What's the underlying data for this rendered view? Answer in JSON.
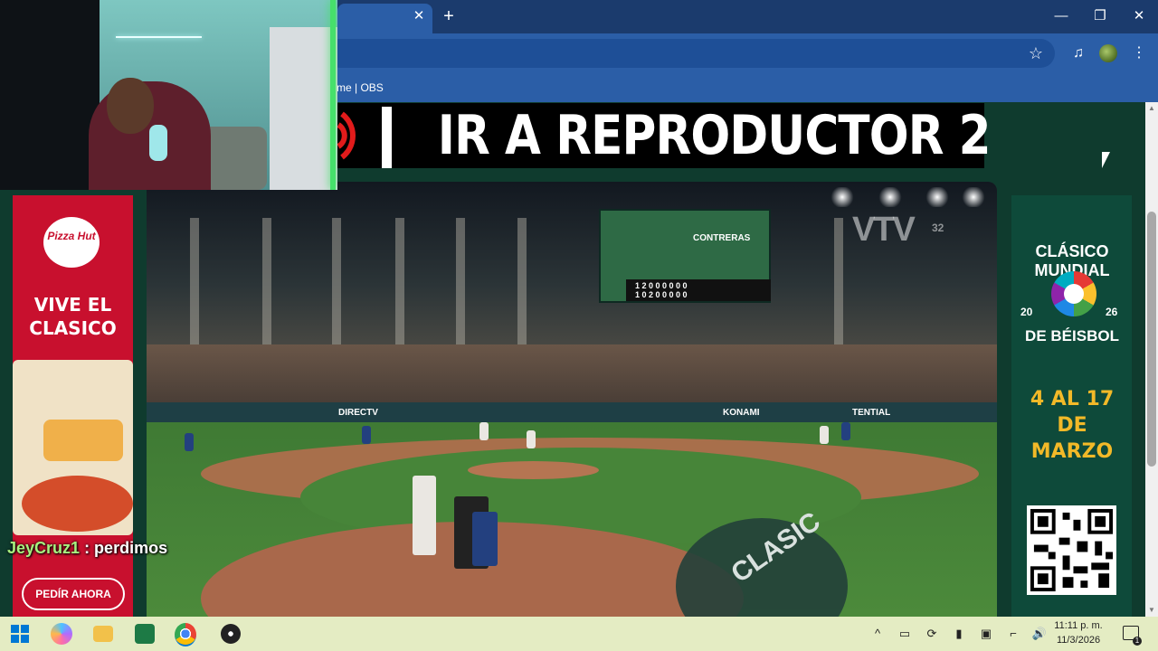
{
  "browser": {
    "tab_close": "✕",
    "new_tab": "+",
    "window": {
      "minimize": "—",
      "restore": "❐",
      "close": "✕"
    },
    "bookmarks": [
      "me | OBS"
    ]
  },
  "stream": {
    "banner_text": "IR A REPRODUCTOR 2"
  },
  "video": {
    "watermark": "VTV",
    "watermark_channel": "32",
    "board_title": "CONTRERAS",
    "board_line1": "1 2 0 0 0 0 0 0",
    "board_line2": "1 0 2 0 0 0 0 0",
    "field_text": "CLASIC",
    "sponsor_1": "DIRECTV",
    "sponsor_2": "KONAMI",
    "sponsor_3": "TENTIAL"
  },
  "ad_left": {
    "logo_text": "Pizza Hut",
    "headline_line1": "VIVE EL",
    "headline_line2": "CLASICO",
    "cta_label": "PEDÍR AHORA"
  },
  "chat": {
    "username": "JeyCruz1",
    "message": ": perdimos"
  },
  "ad_right": {
    "title_top": "CLÁSICO MUNDIAL",
    "year_left": "20",
    "year_right": "26",
    "title_bottom": "DE BÉISBOL",
    "dates_line1": "4 AL 17",
    "dates_line2": "DE",
    "dates_line3": "MARZO"
  },
  "taskbar": {
    "time": "11:11 p. m.",
    "date": "11/3/2026",
    "notif_count": "1"
  },
  "colors": {
    "tabbar": "#1b3b6d",
    "toolbar": "#2b5ea7",
    "page_bg": "#0f3b2e",
    "ad_red": "#c8102e",
    "dates_gold": "#f2b928",
    "taskbar": "#e4ecc3"
  },
  "icons": {
    "star": "☆",
    "media": "♫",
    "menu": "⋮",
    "tray_up": "^",
    "tray_1": "▭",
    "tray_2": "⟳",
    "tray_3": "▮",
    "tray_4": "▣",
    "tray_5": "⌐",
    "tray_6": "🔊"
  }
}
